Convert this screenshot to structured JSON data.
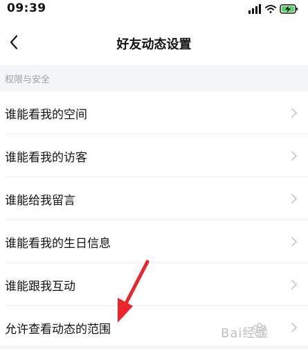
{
  "status": {
    "time": "09:39"
  },
  "nav": {
    "title": "好友动态设置"
  },
  "section": {
    "label": "权限与安全"
  },
  "items": [
    {
      "label": "谁能看我的空间"
    },
    {
      "label": "谁能看我的访客"
    },
    {
      "label": "谁能给我留言"
    },
    {
      "label": "谁能看我的生日信息"
    },
    {
      "label": "谁能跟我互动"
    },
    {
      "label": "允许查看动态的范围"
    }
  ],
  "watermark": {
    "text": "Bai经验"
  },
  "colors": {
    "annotation_arrow": "#e8262b",
    "battery_charging": "#4cd964",
    "section_text": "#9a9fa8",
    "background": "#f4f5f7"
  }
}
